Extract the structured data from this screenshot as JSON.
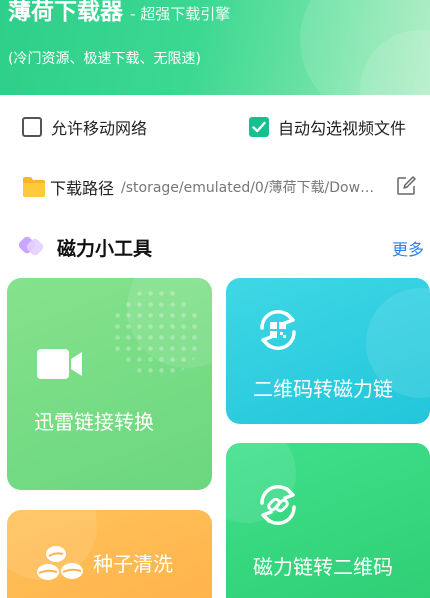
{
  "header": {
    "app_name": "薄荷下载器",
    "subtitle": "- 超强下载引擎",
    "description": "(冷门资源、极速下载、无限速)"
  },
  "options": {
    "mobile_network": {
      "label": "允许移动网络",
      "checked": false
    },
    "auto_select_video": {
      "label": "自动勾选视频文件",
      "checked": true
    }
  },
  "download_path": {
    "label": "下载路径",
    "value": "/storage/emulated/0/薄荷下载/Dow…"
  },
  "tools_section": {
    "title": "磁力小工具",
    "more": "更多"
  },
  "tools": {
    "xunlei": {
      "label": "迅雷链接转换",
      "icon": "video-camera-icon"
    },
    "qr_to_magnet": {
      "label": "二维码转磁力链",
      "icon": "qr-sync-icon"
    },
    "seed_clean": {
      "label": "种子清洗",
      "icon": "seeds-icon"
    },
    "magnet_to_qr": {
      "label": "磁力链转二维码",
      "icon": "link-sync-icon"
    }
  },
  "colors": {
    "brand_green": "#2ecf8a",
    "checkbox_on": "#16c08e",
    "link_blue": "#2f80ed",
    "card_xunlei": "#6ad77f",
    "card_qr": "#22c6da",
    "card_seed": "#ffb14a",
    "card_magnet": "#2fce74"
  }
}
